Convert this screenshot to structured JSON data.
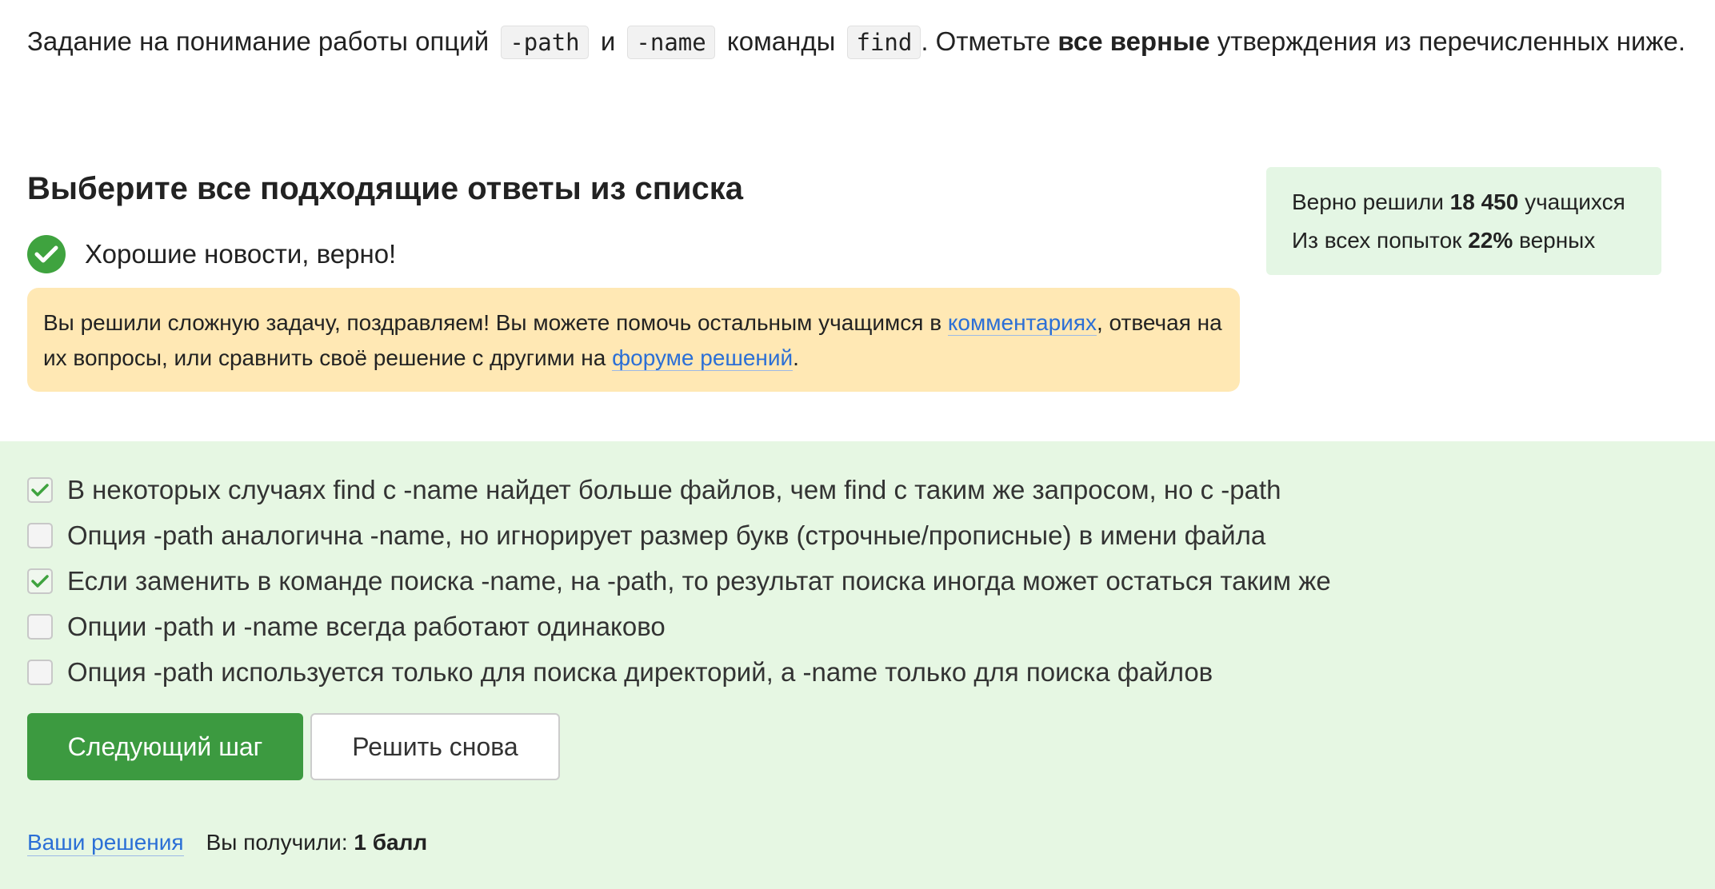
{
  "task": {
    "text_1": "Задание на понимание работы опций",
    "code_1": "-path",
    "text_2": "и",
    "code_2": "-name",
    "text_3": "команды",
    "code_3": "find",
    "text_4": ". Отметьте",
    "bold": "все верные",
    "text_5": "утверждения из перечисленных ниже."
  },
  "question": {
    "title": "Выберите все подходящие ответы из списка",
    "status_text": "Хорошие новости, верно!",
    "status_icon": "check-circle-icon",
    "accent": "#3fa33f"
  },
  "notice": {
    "text_1": "Вы решили сложную задачу, поздравляем! Вы можете помочь остальным учащимся в",
    "link_comments": "комментариях",
    "text_2": ", отвечая на их вопросы, или сравнить своё решение с другими на",
    "link_forum": "форуме решений",
    "text_3": "."
  },
  "stats": {
    "solved_prefix": "Верно решили",
    "solved_count": "18 450",
    "solved_suffix": "учащихся",
    "attempts_prefix": "Из всех попыток",
    "attempts_percent": "22%",
    "attempts_suffix": "верных"
  },
  "options": [
    {
      "label": "В некоторых случаях find с -name найдет больше файлов, чем find с таким же запросом, но с -path",
      "checked": true
    },
    {
      "label": "Опция -path аналогична -name, но игнорирует размер букв (строчные/прописные) в имени файла",
      "checked": false
    },
    {
      "label": "Если заменить в команде поиска -name, на -path, то результат поиска иногда может остаться таким же",
      "checked": true
    },
    {
      "label": "Опции -path и -name всегда работают одинаково",
      "checked": false
    },
    {
      "label": "Опция -path используется только для поиска директорий, а -name только для поиска файлов",
      "checked": false
    }
  ],
  "buttons": {
    "next": "Следующий шаг",
    "retry": "Решить снова"
  },
  "footer": {
    "solutions_link": "Ваши решения",
    "score_prefix": "Вы получили:",
    "score_value": "1 балл"
  }
}
